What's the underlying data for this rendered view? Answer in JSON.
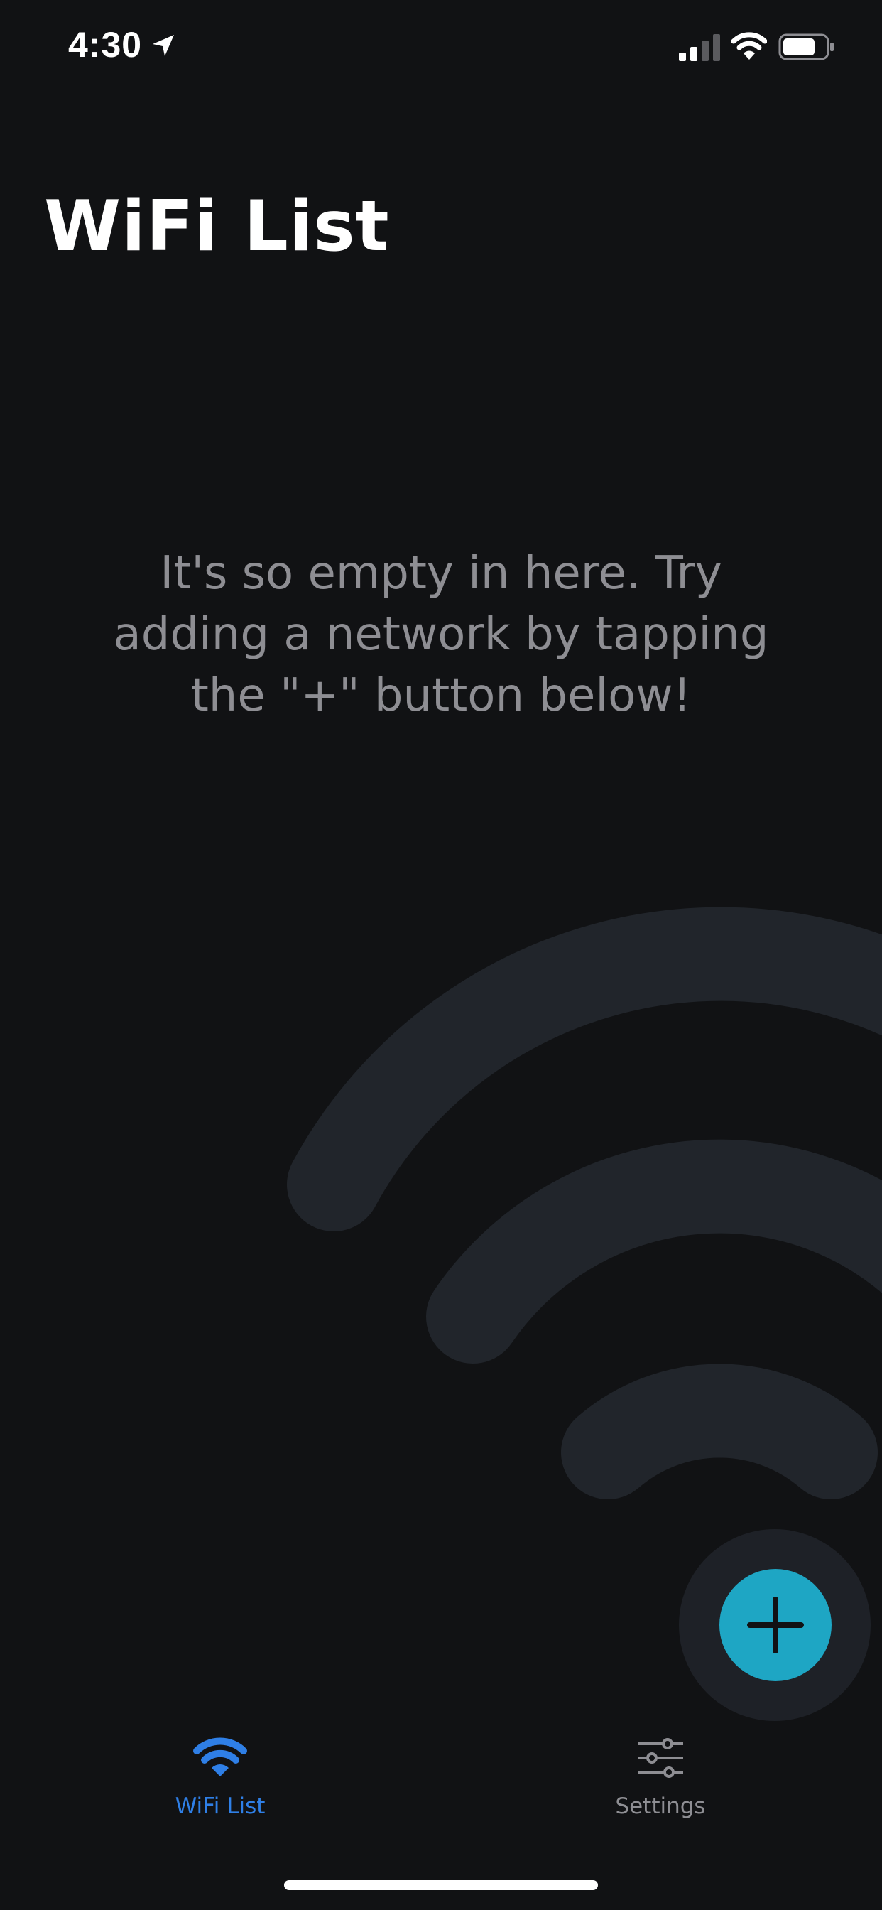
{
  "status_bar": {
    "time": "4:30",
    "icons": [
      "location-arrow-icon",
      "cellular-signal-icon",
      "wifi-icon",
      "battery-icon"
    ]
  },
  "header": {
    "title": "WiFi List"
  },
  "empty_state": {
    "line1": "It's so empty in here. Try",
    "line2": "adding a network by tapping",
    "line3": "the \"+\" button below!"
  },
  "fab": {
    "icon": "plus-icon",
    "color": "#1ea6c4"
  },
  "tab_bar": {
    "tabs": [
      {
        "label": "WiFi List",
        "icon": "wifi-icon",
        "active": true,
        "color": "#2f7fe6"
      },
      {
        "label": "Settings",
        "icon": "sliders-icon",
        "active": false,
        "color": "#8e8e93"
      }
    ]
  },
  "colors": {
    "background": "#111214",
    "decorative_wifi": "#21252b",
    "secondary_text": "#8e8e93"
  }
}
